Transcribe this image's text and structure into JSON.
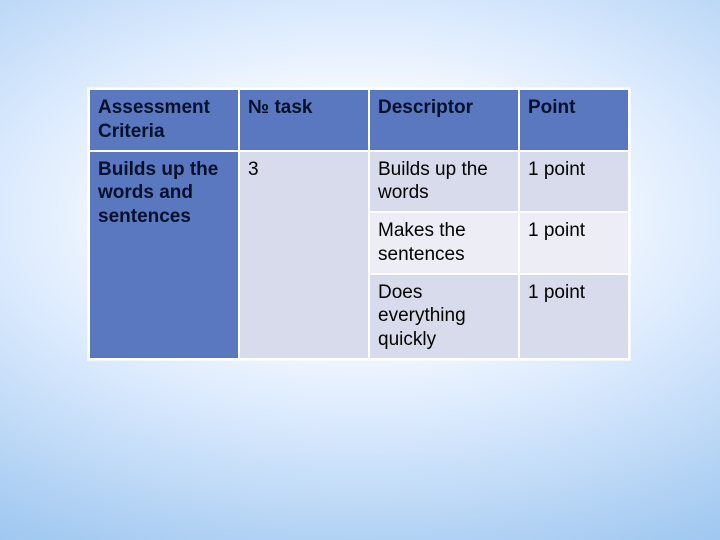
{
  "headers": {
    "criteria": "Assessment Criteria",
    "task": "№  task",
    "descriptor": "Descriptor",
    "point": "Point"
  },
  "criteria": "Builds up the words and sentences",
  "task_no": "3",
  "rows": [
    {
      "descriptor": "Builds up the words",
      "point": "1 point"
    },
    {
      "descriptor": "Makes the sentences",
      "point": "1 point"
    },
    {
      "descriptor": "Does everything quickly",
      "point": "1 point"
    }
  ]
}
